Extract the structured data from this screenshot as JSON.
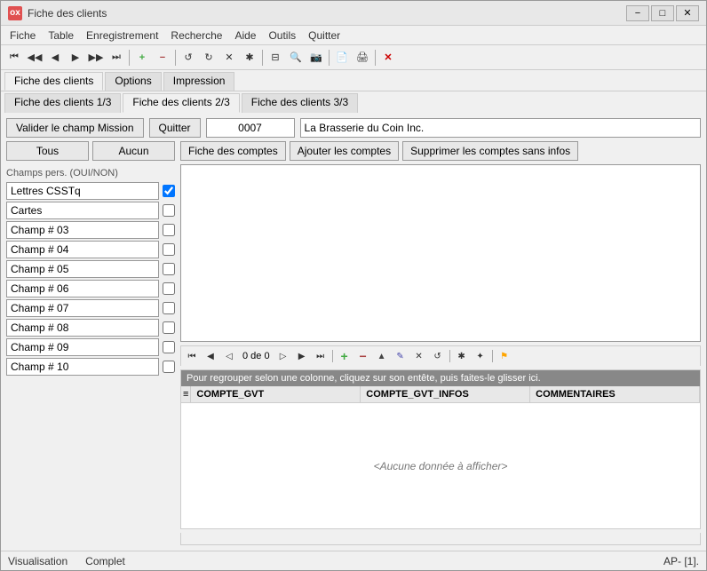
{
  "window": {
    "title": "Fiche des clients",
    "icon_label": "ox"
  },
  "menu": {
    "items": [
      "Fiche",
      "Table",
      "Enregistrement",
      "Recherche",
      "Aide",
      "Outils",
      "Quitter"
    ]
  },
  "toolbar": {
    "buttons": [
      "⏮",
      "◀◀",
      "◀",
      "▶",
      "▶▶",
      "⏭",
      "+",
      "−",
      "×",
      "↺",
      "✕",
      "✱",
      "🔍",
      "📋",
      "📷",
      "⬛",
      "✕"
    ]
  },
  "outer_tabs": {
    "tabs": [
      "Fiche des clients",
      "Options",
      "Impression"
    ]
  },
  "inner_tabs": {
    "tabs": [
      "Fiche des clients 1/3",
      "Fiche des clients 2/3",
      "Fiche des clients 3/3"
    ],
    "active": 1
  },
  "top_bar": {
    "validate_label": "Valider le champ Mission",
    "quit_label": "Quitter",
    "id_value": "0007",
    "name_value": "La Brasserie du Coin Inc."
  },
  "left_panel": {
    "tous_label": "Tous",
    "aucun_label": "Aucun",
    "section_label": "Champs pers. (OUI/NON)",
    "fields": [
      {
        "label": "Lettres CSSTq",
        "checked": true
      },
      {
        "label": "Cartes",
        "checked": false
      },
      {
        "label": "Champ # 03",
        "checked": false
      },
      {
        "label": "Champ # 04",
        "checked": false
      },
      {
        "label": "Champ # 05",
        "checked": false
      },
      {
        "label": "Champ # 06",
        "checked": false
      },
      {
        "label": "Champ # 07",
        "checked": false
      },
      {
        "label": "Champ # 08",
        "checked": false
      },
      {
        "label": "Champ # 09",
        "checked": false
      },
      {
        "label": "Champ # 10",
        "checked": false
      }
    ]
  },
  "right_panel": {
    "fiche_btn": "Fiche des comptes",
    "ajouter_btn": "Ajouter les comptes",
    "supprimer_btn": "Supprimer les comptes sans infos",
    "group_hint": "Pour regrouper selon une colonne, cliquez sur son entête, puis faites-le glisser ici.",
    "grid_page": "0 de 0",
    "columns": [
      "COMPTE_GVT",
      "COMPTE_GVT_INFOS",
      "COMMENTAIRES"
    ],
    "empty_label": "<Aucune donnée à afficher>"
  },
  "status_bar": {
    "mode": "Visualisation",
    "state": "Complet",
    "position": "AP- [1]."
  }
}
